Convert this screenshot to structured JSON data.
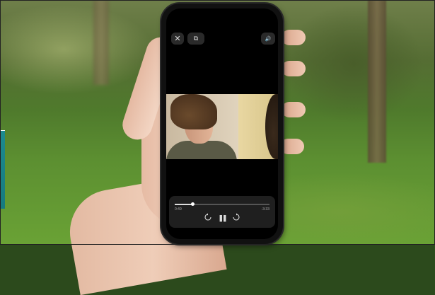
{
  "player": {
    "close_icon": "✕",
    "pip_icon": "⧉",
    "volume_icon": "🔊",
    "progress": 0.19,
    "elapsed": "0:49",
    "remaining": "-3:33",
    "rewind_label": "15",
    "forward_label": "15",
    "pause_icon": "❚❚"
  },
  "colors": {
    "screen_bg": "#000000",
    "control_bg": "#2a2a2a",
    "teal_edge": "#1c8a8f"
  }
}
